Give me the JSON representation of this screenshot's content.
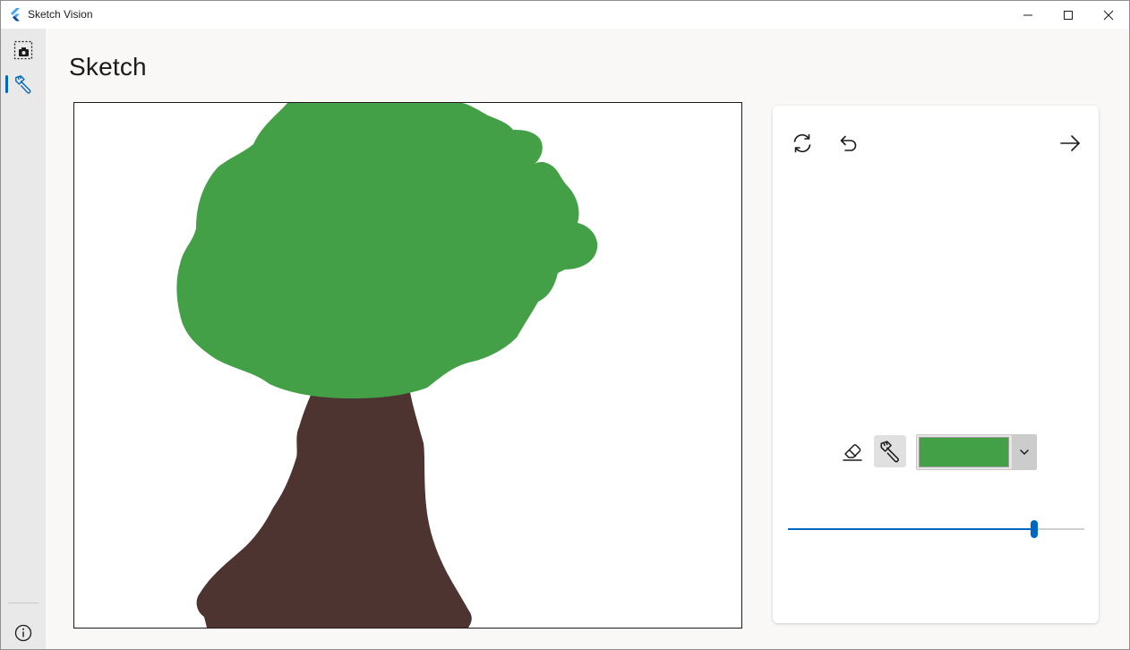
{
  "window": {
    "title": "Sketch Vision",
    "logo_icon": "flutter-logo-icon",
    "controls": [
      "minimize-icon",
      "maximize-icon",
      "close-icon"
    ]
  },
  "navigation": {
    "items": [
      {
        "name": "capture",
        "icon": "screen-capture-icon",
        "selected": false
      },
      {
        "name": "sketch",
        "icon": "brush-icon",
        "selected": true
      }
    ],
    "footer_icon": "info-icon",
    "accent_color": "#0067c0"
  },
  "page": {
    "title": "Sketch"
  },
  "canvas": {
    "drawing": "tree",
    "colors": {
      "foliage": "#43a047",
      "trunk": "#4e3430",
      "background": "#ffffff"
    }
  },
  "panel": {
    "actions": [
      {
        "name": "reset",
        "icon": "refresh-icon"
      },
      {
        "name": "undo",
        "icon": "undo-icon"
      },
      {
        "name": "next",
        "icon": "arrow-right-icon"
      }
    ],
    "tools": [
      {
        "name": "eraser",
        "icon": "eraser-icon",
        "selected": false
      },
      {
        "name": "brush",
        "icon": "brush-icon",
        "selected": true
      }
    ],
    "selected_color": "#43a047",
    "dropdown_icon": "chevron-down-icon",
    "brush_size_fraction": 0.83
  }
}
